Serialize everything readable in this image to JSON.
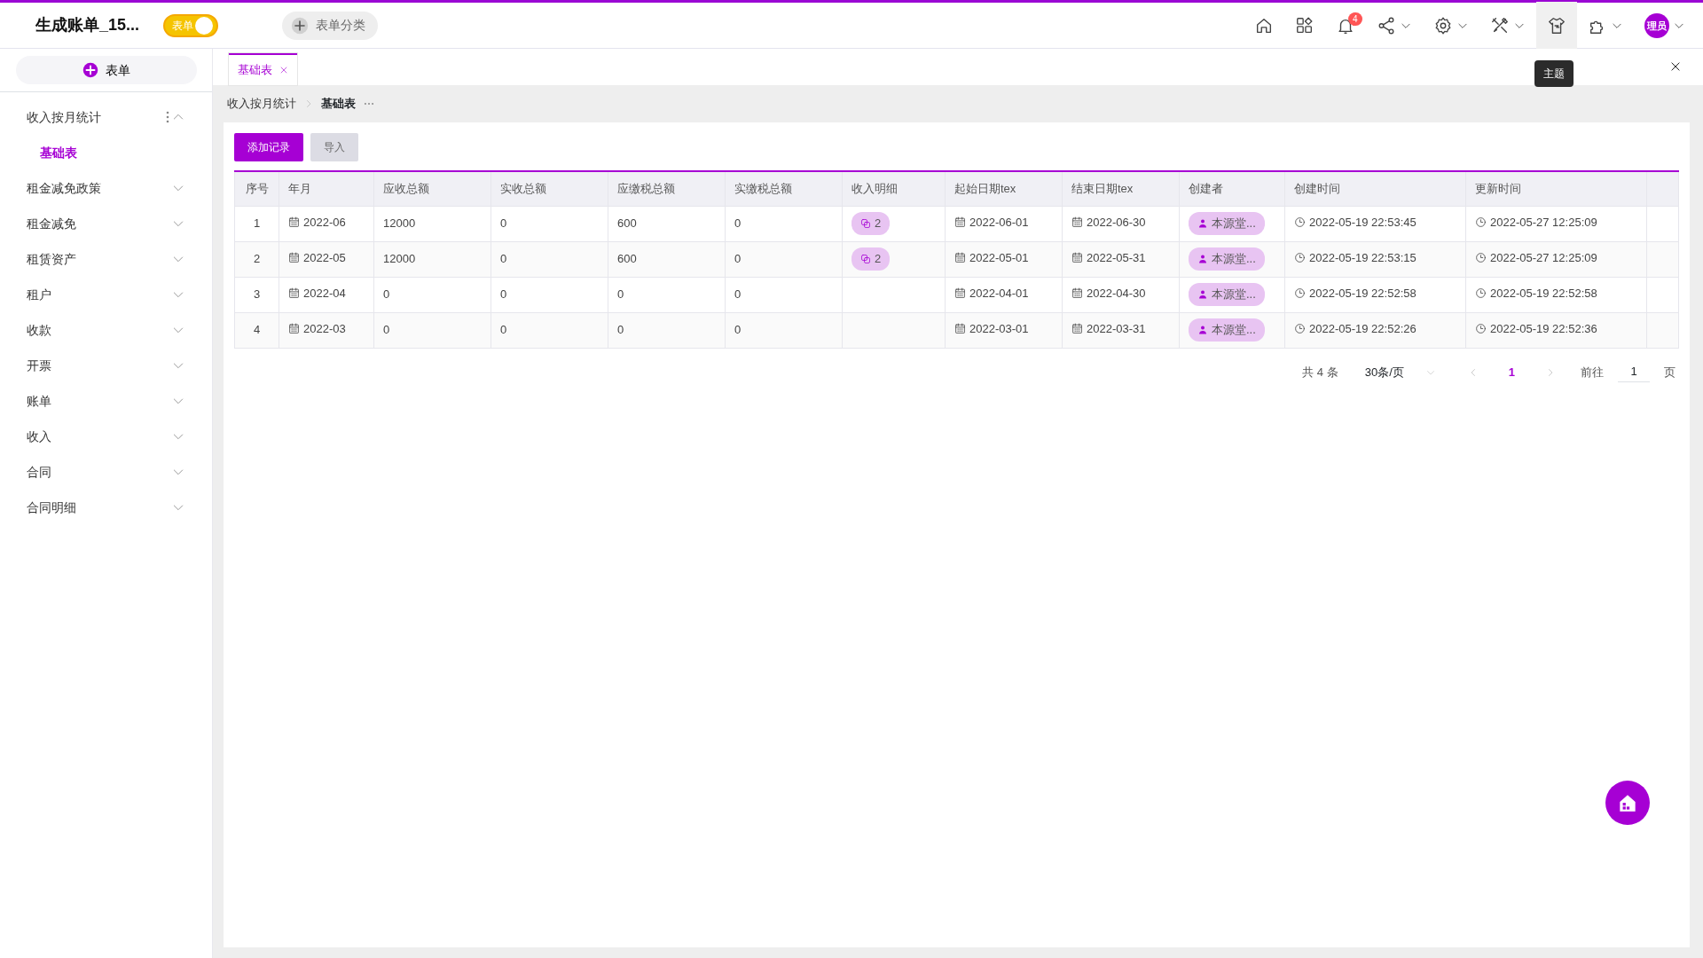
{
  "header": {
    "title": "生成账单_15...",
    "toggle": {
      "label": "表单",
      "on": true
    },
    "category_button": "表单分类",
    "icons": [
      {
        "kind": "home",
        "caret": false,
        "hovered": false
      },
      {
        "kind": "apps",
        "caret": false,
        "hovered": false
      },
      {
        "kind": "bell",
        "caret": false,
        "hovered": false,
        "badge": "4"
      },
      {
        "kind": "share",
        "caret": true,
        "hovered": false
      },
      {
        "kind": "gear",
        "caret": true,
        "hovered": false
      },
      {
        "kind": "tools",
        "caret": true,
        "hovered": false
      },
      {
        "kind": "shirt",
        "caret": false,
        "hovered": true,
        "tooltip": "主题"
      },
      {
        "kind": "puzzle",
        "caret": true,
        "hovered": false
      },
      {
        "kind": "avatar",
        "caret": true,
        "hovered": false,
        "text": "理员"
      }
    ]
  },
  "sidebar": {
    "new_button": "表单",
    "items": [
      {
        "label": "收入按月统计",
        "expanded": true,
        "children": [
          {
            "label": "基础表",
            "selected": true
          }
        ]
      },
      {
        "label": "租金减免政策",
        "expanded": false
      },
      {
        "label": "租金减免",
        "expanded": false
      },
      {
        "label": "租赁资产",
        "expanded": false
      },
      {
        "label": "租户",
        "expanded": false
      },
      {
        "label": "收款",
        "expanded": false
      },
      {
        "label": "开票",
        "expanded": false
      },
      {
        "label": "账单",
        "expanded": false
      },
      {
        "label": "收入",
        "expanded": false
      },
      {
        "label": "合同",
        "expanded": false
      },
      {
        "label": "合同明细",
        "expanded": false
      }
    ]
  },
  "tabs": [
    {
      "label": "基础表",
      "selected": true
    }
  ],
  "breadcrumb": [
    "收入按月统计",
    "基础表"
  ],
  "actions": [
    {
      "label": "添加记录",
      "kind": "primary"
    },
    {
      "label": "导入",
      "kind": "secondary"
    }
  ],
  "table": {
    "columns": [
      {
        "label": "序号",
        "kind": "index"
      },
      {
        "label": "年月",
        "kind": "date"
      },
      {
        "label": "应收总额",
        "kind": "text"
      },
      {
        "label": "实收总额",
        "kind": "text"
      },
      {
        "label": "应缴税总额",
        "kind": "text"
      },
      {
        "label": "实缴税总额",
        "kind": "text"
      },
      {
        "label": "收入明细",
        "kind": "link"
      },
      {
        "label": "起始日期tex",
        "kind": "date"
      },
      {
        "label": "结束日期tex",
        "kind": "date"
      },
      {
        "label": "创建者",
        "kind": "user"
      },
      {
        "label": "创建时间",
        "kind": "time"
      },
      {
        "label": "更新时间",
        "kind": "time"
      }
    ],
    "rows": [
      [
        "1",
        "2022-06",
        "12000",
        "0",
        "600",
        "0",
        "2",
        "2022-06-01",
        "2022-06-30",
        "本源堂...",
        "2022-05-19 22:53:45",
        "2022-05-27 12:25:09"
      ],
      [
        "2",
        "2022-05",
        "12000",
        "0",
        "600",
        "0",
        "2",
        "2022-05-01",
        "2022-05-31",
        "本源堂...",
        "2022-05-19 22:53:15",
        "2022-05-27 12:25:09"
      ],
      [
        "3",
        "2022-04",
        "0",
        "0",
        "0",
        "0",
        null,
        "2022-04-01",
        "2022-04-30",
        "本源堂...",
        "2022-05-19 22:52:58",
        "2022-05-19 22:52:58"
      ],
      [
        "4",
        "2022-03",
        "0",
        "0",
        "0",
        "0",
        null,
        "2022-03-01",
        "2022-03-31",
        "本源堂...",
        "2022-05-19 22:52:26",
        "2022-05-19 22:52:36"
      ]
    ]
  },
  "pagination": {
    "total": "共 4 条",
    "page_size": "30条/页",
    "current_page": "1",
    "goto_label": "前往",
    "goto_value": "1",
    "page_suffix": "页"
  }
}
